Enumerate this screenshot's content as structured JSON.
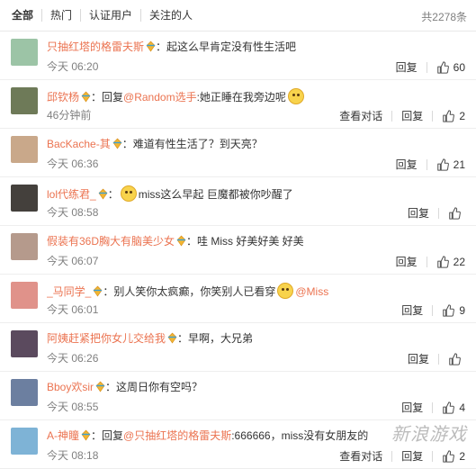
{
  "tabs": [
    "全部",
    "热门",
    "认证用户",
    "关注的人"
  ],
  "total_count": "共2278条",
  "comments": [
    {
      "user": "只抽红塔的格雷夫斯",
      "text": "：起这么早肯定没有性生活吧",
      "time": "今天 06:20",
      "view_thread": "",
      "reply": "回复",
      "likes": "60",
      "avatar_color": "#9cc4a6"
    },
    {
      "user": "邱钦杨",
      "text_prefix": "：回复",
      "mention": "@Random选手",
      "text": ":她正睡在我旁边呢",
      "time": "46分钟前",
      "view_thread": "查看对话",
      "reply": "回复",
      "likes": "2",
      "avatar_color": "#6e7a58"
    },
    {
      "user": "BacKache-其",
      "text": "：难道有性生活了？到天亮？",
      "time": "今天 06:36",
      "view_thread": "",
      "reply": "回复",
      "likes": "21",
      "avatar_color": "#c9a88a"
    },
    {
      "user": "lol代练君_",
      "text": "：",
      "text_after": "miss这么早起 巨魔都被你吵醒了",
      "time": "今天 08:58",
      "view_thread": "",
      "reply": "回复",
      "likes": "",
      "avatar_color": "#44403c"
    },
    {
      "user": "假装有36D胸大有脑美少女",
      "text": "：哇 Miss 好美好美 好美",
      "time": "今天 06:07",
      "view_thread": "",
      "reply": "回复",
      "likes": "22",
      "avatar_color": "#b59a8c"
    },
    {
      "user": "_马同学_",
      "text": "：别人笑你太疯癫，你笑别人已看穿",
      "mention": "@Miss",
      "time": "今天 06:01",
      "view_thread": "",
      "reply": "回复",
      "likes": "9",
      "avatar_color": "#e0928a"
    },
    {
      "user": "阿姨赶紧把你女儿交给我",
      "text": "：早啊，大兄弟",
      "time": "今天 06:26",
      "view_thread": "",
      "reply": "回复",
      "likes": "",
      "avatar_color": "#5b4a5e"
    },
    {
      "user": "Bboy欢sir",
      "text": "：这周日你有空吗？",
      "time": "今天 08:55",
      "view_thread": "",
      "reply": "回复",
      "likes": "4",
      "avatar_color": "#6c7fa0"
    },
    {
      "user": "A-神瞳",
      "text_prefix": "：回复",
      "mention": "@只抽红塔的格雷夫斯",
      "text": ":666666，miss没有女朋友的",
      "time": "今天 08:18",
      "view_thread": "查看对话",
      "reply": "回复",
      "likes": "2",
      "avatar_color": "#7eb3d6"
    }
  ],
  "watermark": "新浪游戏",
  "colors": {
    "username": "#eb7350",
    "muted": "#808080"
  }
}
